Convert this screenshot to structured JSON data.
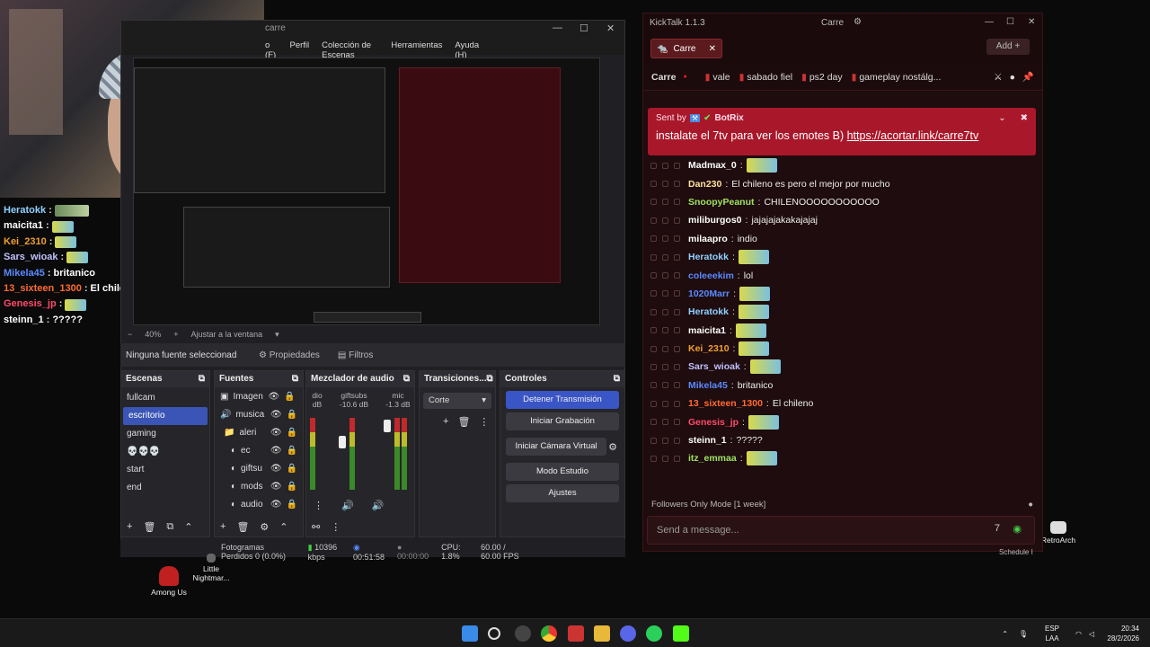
{
  "overlay_chat": [
    {
      "user": "Heratokk",
      "color": "#8fd0ff",
      "text": ""
    },
    {
      "user": "maicita1",
      "color": "#ffffff",
      "text": ""
    },
    {
      "user": "Kei_2310",
      "color": "#f0a030",
      "text": ""
    },
    {
      "user": "Sars_wioak",
      "color": "#c0c0ff",
      "text": ""
    },
    {
      "user": "Mikela45",
      "color": "#5a8aff",
      "text": "britanico"
    },
    {
      "user": "13_sixteen_1300",
      "color": "#ff6a30",
      "text": "El chileno"
    },
    {
      "user": "Genesis_jp",
      "color": "#ff4a6a",
      "text": ""
    },
    {
      "user": "steinn_1",
      "color": "#ffffff",
      "text": "?????"
    }
  ],
  "obs": {
    "title": "carre",
    "menu": [
      "o (F)",
      "Perfil",
      "Colección de Escenas",
      "Herramientas",
      "Ayuda (H)"
    ],
    "zoom": "40%",
    "zoom_mode": "Ajustar a la ventana",
    "no_source": "Ninguna fuente seleccionad",
    "properties": "Propiedades",
    "filters": "Filtros",
    "docks": {
      "scenes": "Escenas",
      "sources": "Fuentes",
      "mixer": "Mezclador de audio",
      "transitions": "Transiciones...",
      "controls": "Controles"
    },
    "scenes": [
      "fullcam",
      "escritorio",
      "gaming",
      "💀💀💀",
      "start",
      "end"
    ],
    "selected_scene": "escritorio",
    "sources": [
      "Imagen",
      "musica",
      "aleri",
      "ec",
      "giftsu",
      "mods",
      "audio"
    ],
    "mixer": [
      {
        "name": "dio",
        "db": "dB"
      },
      {
        "name": "giftsubs",
        "db": "-10.6 dB"
      },
      {
        "name": "mic",
        "db": "-1.3 dB"
      }
    ],
    "transition": "Corte",
    "controls": [
      "Detener Transmisión",
      "Iniciar Grabación",
      "Iniciar Cámara Virtual",
      "Modo Estudio",
      "Ajustes"
    ],
    "status": {
      "dropped": "Fotogramas Perdidos 0 (0.0%)",
      "bitrate": "10396 kbps",
      "live_time": "00:51:58",
      "rec_time": "00:00:00",
      "cpu": "CPU: 1.8%",
      "fps": "60.00 / 60.00 FPS"
    }
  },
  "desktop_icons": [
    {
      "label": "Among Us"
    },
    {
      "label": "Little Nightmar..."
    },
    {
      "label": "RetroArch"
    }
  ],
  "kicktalk": {
    "title": "KickTalk 1.1.3",
    "account": "Carre",
    "tab": "Carre",
    "add": "Add",
    "channel": "Carre",
    "tags": [
      "vale",
      "sabado fiel",
      "ps2 day",
      "gameplay nostálg..."
    ],
    "pinned": {
      "by_prefix": "Sent by",
      "by_user": "BotRix",
      "text": "instalate el 7tv para ver los emotes B)",
      "link": "https://acortar.link/carre7tv"
    },
    "messages": [
      {
        "user": "Madmax_0",
        "color": "#ffffff",
        "text": "",
        "emote": true
      },
      {
        "user": "Dan230",
        "color": "#ffe0a0",
        "text": "El chileno es pero el mejor por mucho"
      },
      {
        "user": "SnoopyPeanut",
        "color": "#a0e060",
        "text": "CHILENOOOOOOOOOOO"
      },
      {
        "user": "miliburgos0",
        "color": "#ffffff",
        "text": "jajajajakakajajaj"
      },
      {
        "user": "milaapro",
        "color": "#ffffff",
        "text": "indio"
      },
      {
        "user": "Heratokk",
        "color": "#8fd0ff",
        "text": "",
        "emote": true
      },
      {
        "user": "coleeekim",
        "color": "#5a8aff",
        "text": "lol"
      },
      {
        "user": "1020Marr",
        "color": "#5a8aff",
        "text": "",
        "emote": true
      },
      {
        "user": "Heratokk",
        "color": "#8fd0ff",
        "text": "",
        "emote": true
      },
      {
        "user": "maicita1",
        "color": "#ffffff",
        "text": "",
        "emote": true
      },
      {
        "user": "Kei_2310",
        "color": "#f0a030",
        "text": "",
        "emote": true
      },
      {
        "user": "Sars_wioak",
        "color": "#c0c0ff",
        "text": "",
        "emote": true
      },
      {
        "user": "Mikela45",
        "color": "#5a8aff",
        "text": "britanico"
      },
      {
        "user": "13_sixteen_1300",
        "color": "#ff6a30",
        "text": "El chileno"
      },
      {
        "user": "Genesis_jp",
        "color": "#ff4a6a",
        "text": "",
        "emote": true
      },
      {
        "user": "steinn_1",
        "color": "#ffffff",
        "text": "?????"
      },
      {
        "user": "itz_emmaa",
        "color": "#a0e060",
        "text": "",
        "emote": true
      }
    ],
    "follow_mode": "Followers Only Mode [1 week]",
    "input_placeholder": "Send a message...",
    "schedule": "Schedule I"
  },
  "taskbar": {
    "lang": "ESP",
    "region": "LAA",
    "time": "20:34",
    "date": "28/2/2026"
  }
}
